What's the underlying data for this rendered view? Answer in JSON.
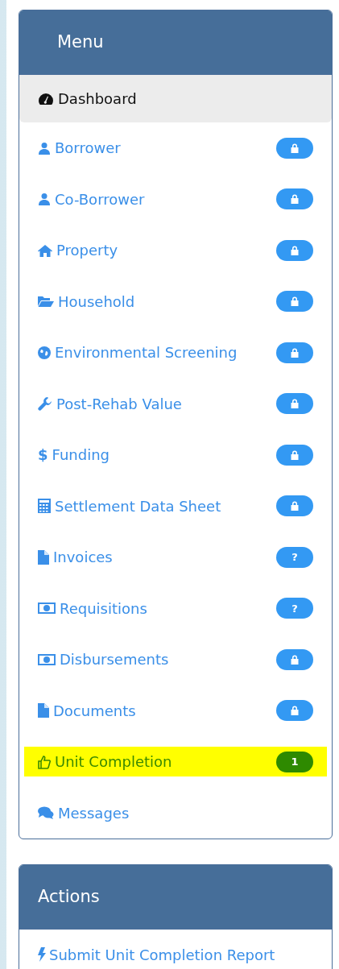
{
  "menu": {
    "title": "Menu",
    "items": [
      {
        "label": "Dashboard",
        "selected": true,
        "highlighted": false
      },
      {
        "label": "Borrower",
        "selected": false,
        "highlighted": false,
        "badge": {
          "kind": "lock",
          "color": "#3399f3"
        }
      },
      {
        "label": "Co-Borrower",
        "selected": false,
        "highlighted": false,
        "badge": {
          "kind": "lock",
          "color": "#3399f3"
        }
      },
      {
        "label": "Property",
        "selected": false,
        "highlighted": false,
        "badge": {
          "kind": "lock",
          "color": "#3399f3"
        }
      },
      {
        "label": "Household",
        "selected": false,
        "highlighted": false,
        "badge": {
          "kind": "lock",
          "color": "#3399f3"
        }
      },
      {
        "label": "Environmental Screening",
        "selected": false,
        "highlighted": false,
        "badge": {
          "kind": "lock",
          "color": "#3399f3"
        }
      },
      {
        "label": "Post-Rehab Value",
        "selected": false,
        "highlighted": false,
        "badge": {
          "kind": "lock",
          "color": "#3399f3"
        }
      },
      {
        "label": "Funding",
        "icon_char": "$",
        "selected": false,
        "highlighted": false,
        "badge": {
          "kind": "lock",
          "color": "#3399f3"
        }
      },
      {
        "label": "Settlement Data Sheet",
        "selected": false,
        "highlighted": false,
        "badge": {
          "kind": "lock",
          "color": "#3399f3"
        }
      },
      {
        "label": "Invoices",
        "selected": false,
        "highlighted": false,
        "badge": {
          "kind": "text",
          "text": "?",
          "color": "#3399f3"
        }
      },
      {
        "label": "Requisitions",
        "selected": false,
        "highlighted": false,
        "badge": {
          "kind": "text",
          "text": "?",
          "color": "#3399f3"
        }
      },
      {
        "label": "Disbursements",
        "selected": false,
        "highlighted": false,
        "badge": {
          "kind": "lock",
          "color": "#3399f3"
        }
      },
      {
        "label": "Documents",
        "selected": false,
        "highlighted": false,
        "badge": {
          "kind": "lock",
          "color": "#3399f3"
        }
      },
      {
        "label": "Unit Completion",
        "selected": false,
        "highlighted": true,
        "badge": {
          "kind": "text",
          "text": "1",
          "color": "#2e8a00"
        }
      },
      {
        "label": "Messages",
        "selected": false,
        "highlighted": false
      }
    ]
  },
  "actions": {
    "title": "Actions",
    "items": [
      {
        "label": "Submit Unit Completion Report"
      }
    ]
  }
}
